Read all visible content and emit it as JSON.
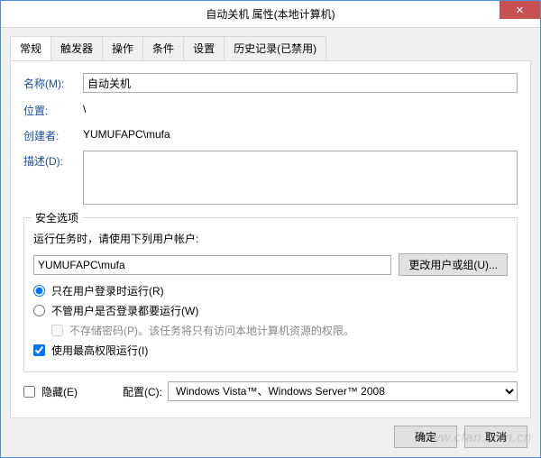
{
  "window": {
    "title": "自动关机 属性(本地计算机)",
    "close": "✕"
  },
  "tabs": {
    "general": "常规",
    "triggers": "触发器",
    "actions": "操作",
    "conditions": "条件",
    "settings": "设置",
    "history": "历史记录(已禁用)"
  },
  "general": {
    "name_label": "名称(M):",
    "name_value": "自动关机",
    "location_label": "位置:",
    "location_value": "\\",
    "author_label": "创建者:",
    "author_value": "YUMUFAPC\\mufa",
    "desc_label": "描述(D):",
    "desc_value": ""
  },
  "security": {
    "legend": "安全选项",
    "runas_desc": "运行任务时，请使用下列用户帐户:",
    "account": "YUMUFAPC\\mufa",
    "change_user_btn": "更改用户或组(U)...",
    "radio_logged_on": "只在用户登录时运行(R)",
    "radio_any": "不管用户是否登录都要运行(W)",
    "no_store_pwd": "不存储密码(P)。该任务将只有访问本地计算机资源的权限。",
    "highest_priv": "使用最高权限运行(I)"
  },
  "bottom": {
    "hidden_label": "隐藏(E)",
    "config_label": "配置(C):",
    "config_value": "Windows Vista™、Windows Server™ 2008"
  },
  "buttons": {
    "ok": "确定",
    "cancel": "取消"
  },
  "watermark": "www.cfan.com.cn"
}
